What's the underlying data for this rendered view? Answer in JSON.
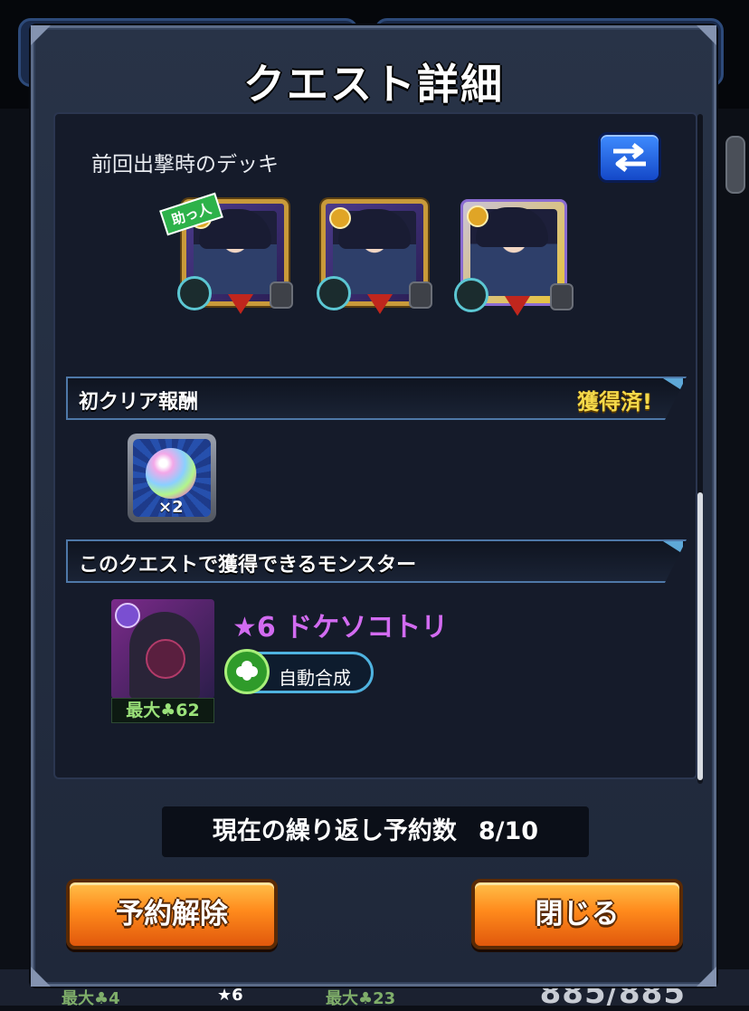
{
  "dialog": {
    "title": "クエスト詳細"
  },
  "deck": {
    "label": "前回出撃時のデッキ",
    "helper_tag": "助っ人",
    "swap_icon": "swap-arrows-icon"
  },
  "first_clear": {
    "title": "初クリア報酬",
    "status": "獲得済!",
    "reward_count": "×2"
  },
  "obtainable": {
    "title": "このクエストで獲得できるモンスター",
    "monster_name": "★6 ドケソコトリ",
    "level_label": "最大",
    "level_value": "62",
    "auto_fuse_label": "自動合成"
  },
  "repeat": {
    "label": "現在の繰り返し予約数",
    "value": "8/10"
  },
  "buttons": {
    "cancel_reservation": "予約解除",
    "close": "閉じる"
  },
  "background": {
    "bottom_left_label": "最大",
    "bottom_left_value": "4",
    "bottom_mid_label": "★6",
    "bottom_right_label": "最大",
    "bottom_right_value": "23",
    "bottom_stamina": "885/885"
  },
  "colors": {
    "accent_orange": "#ff8a1c",
    "monster_name": "#d26bf1",
    "status_gold": "#f5d94a",
    "section_border": "#4e78a8"
  }
}
